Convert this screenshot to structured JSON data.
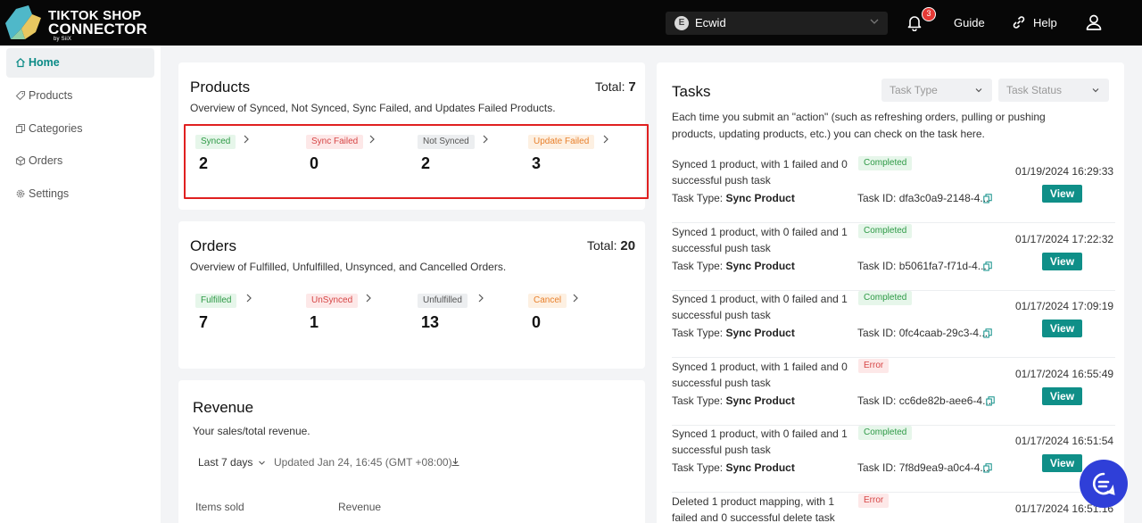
{
  "header": {
    "logo_line1": "TIKTOK SHOP",
    "logo_line2": "CONNECTOR",
    "logo_by": "by SiiX",
    "store_initial": "E",
    "store_name": "Ecwid",
    "notification_count": "3",
    "guide_label": "Guide",
    "help_label": "Help"
  },
  "sidebar": {
    "items": [
      {
        "label": "Home",
        "icon": "home-icon"
      },
      {
        "label": "Products",
        "icon": "tag-icon"
      },
      {
        "label": "Categories",
        "icon": "copy-icon"
      },
      {
        "label": "Orders",
        "icon": "box-icon"
      },
      {
        "label": "Settings",
        "icon": "gear-icon"
      }
    ]
  },
  "products": {
    "title": "Products",
    "total_label": "Total:",
    "total": "7",
    "desc": "Overview of Synced, Not Synced, Sync Failed, and Updates Failed Products.",
    "stats": [
      {
        "label": "Synced",
        "value": "2"
      },
      {
        "label": "Sync Failed",
        "value": "0"
      },
      {
        "label": "Not Synced",
        "value": "2"
      },
      {
        "label": "Update Failed",
        "value": "3"
      }
    ]
  },
  "orders": {
    "title": "Orders",
    "total_label": "Total:",
    "total": "20",
    "desc": "Overview of Fulfilled, Unfulfilled, Unsynced, and Cancelled Orders.",
    "stats": [
      {
        "label": "Fulfilled",
        "value": "7"
      },
      {
        "label": "UnSynced",
        "value": "1"
      },
      {
        "label": "Unfulfilled",
        "value": "13"
      },
      {
        "label": "Cancel",
        "value": "0"
      }
    ]
  },
  "revenue": {
    "title": "Revenue",
    "desc": "Your sales/total revenue.",
    "filter": "Last 7 days",
    "updated": "Updated Jan 24, 16:45 (GMT +08:00)",
    "col_items": "Items sold",
    "col_revenue": "Revenue"
  },
  "tasks": {
    "title": "Tasks",
    "type_placeholder": "Task Type",
    "status_placeholder": "Task Status",
    "desc": "Each time you submit an \"action\" (such as refreshing orders, pulling or pushing products, updating products, etc.) you can check on the task here.",
    "type_label": "Task Type:",
    "id_label": "Task ID:",
    "view_label": "View",
    "rows": [
      {
        "desc": "Synced 1 product, with 1 failed and 0 successful push task",
        "status": "Completed",
        "type": "Sync Product",
        "id": "dfa3c0a9-2148-4...",
        "time": "01/19/2024 16:29:33"
      },
      {
        "desc": "Synced 1 product, with 0 failed and 1 successful push task",
        "status": "Completed",
        "type": "Sync Product",
        "id": "b5061fa7-f71d-4...",
        "time": "01/17/2024 17:22:32"
      },
      {
        "desc": "Synced 1 product, with 0 failed and 1 successful push task",
        "status": "Completed",
        "type": "Sync Product",
        "id": "0fc4caab-29c3-4...",
        "time": "01/17/2024 17:09:19"
      },
      {
        "desc": "Synced 1 product, with 1 failed and 0 successful push task",
        "status": "Error",
        "type": "Sync Product",
        "id": "cc6de82b-aee6-4...",
        "time": "01/17/2024 16:55:49"
      },
      {
        "desc": "Synced 1 product, with 0 failed and 1 successful push task",
        "status": "Completed",
        "type": "Sync Product",
        "id": "7f8d9ea9-a0c4-4...",
        "time": "01/17/2024 16:51:54"
      },
      {
        "desc": "Deleted 1 product mapping, with 1 failed and 0 successful delete task",
        "status": "Error",
        "time": "01/17/2024 16:51:16"
      }
    ]
  },
  "colors": {
    "accent": "#0f8f88",
    "header_bg": "#070707",
    "highlight": "#e02020"
  }
}
